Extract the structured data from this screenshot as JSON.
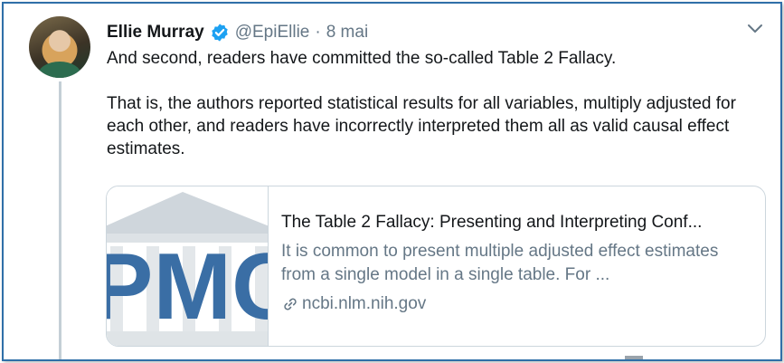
{
  "tweet": {
    "author_name": "Ellie Murray",
    "handle": "@EpiEllie",
    "separator": "·",
    "date": "8 mai",
    "paragraphs": [
      "And second, readers have committed the so-called Table 2 Fallacy.",
      "That is, the authors reported statistical results for all variables, multiply adjusted for each other, and readers have incorrectly interpreted them all as valid causal effect estimates."
    ]
  },
  "card": {
    "title": "The Table 2 Fallacy: Presenting and Interpreting Conf...",
    "description": "It is common to present multiple adjusted effect estimates from a single model in a single table. For ...",
    "domain": "ncbi.nlm.nih.gov",
    "thumbnail_text": "PMC"
  },
  "icons": {
    "verified": "verified-badge-icon",
    "menu": "chevron-down-icon",
    "link": "link-icon"
  },
  "colors": {
    "accent": "#1da1f2",
    "secondary_text": "#657786",
    "frame_border": "#2f6fa8",
    "pmc_blue": "#3a6ea5"
  }
}
